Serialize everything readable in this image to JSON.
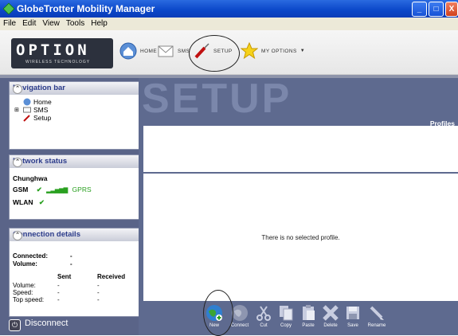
{
  "window": {
    "title": "GlobeTrotter Mobility Manager",
    "buttons": [
      "_",
      "□",
      "X"
    ]
  },
  "menu": [
    "File",
    "Edit",
    "View",
    "Tools",
    "Help"
  ],
  "toolbar": {
    "logo": "OPTION",
    "logo_tag": "WIRELESS TECHNOLOGY",
    "home": "Home",
    "sms": "SMS",
    "setup": "Setup",
    "my_options": "My Options",
    "my_options_caret": "▼"
  },
  "nav": {
    "title": "Navigation bar",
    "items": [
      "Home",
      "SMS",
      "Setup"
    ]
  },
  "network": {
    "title": "Network status",
    "operator": "Chunghwa",
    "gsm": "GSM",
    "gprs": "GPRS",
    "wlan": "WLAN",
    "check": "✔"
  },
  "connection": {
    "title": "Connection details",
    "connected_label": "Connected:",
    "connected_value": "-",
    "volume_label": "Volume:",
    "volume_value": "-",
    "col_sent": "Sent",
    "col_received": "Received",
    "rows": [
      {
        "label": "Volume:",
        "sent": "-",
        "received": "-"
      },
      {
        "label": "Speed:",
        "sent": "-",
        "received": "-"
      },
      {
        "label": "Top speed:",
        "sent": "-",
        "received": "-"
      }
    ]
  },
  "disconnect": "Disconnect",
  "main": {
    "title": "SETUP",
    "profiles": "Profiles",
    "empty_msg": "There is no selected profile."
  },
  "actions": [
    "New",
    "Connect",
    "Cut",
    "Copy",
    "Paste",
    "Delete",
    "Save",
    "Rename"
  ],
  "colors": {
    "titlebar": "#0a46c8",
    "pane": "#5a6488",
    "accent_green": "#2aa020"
  }
}
